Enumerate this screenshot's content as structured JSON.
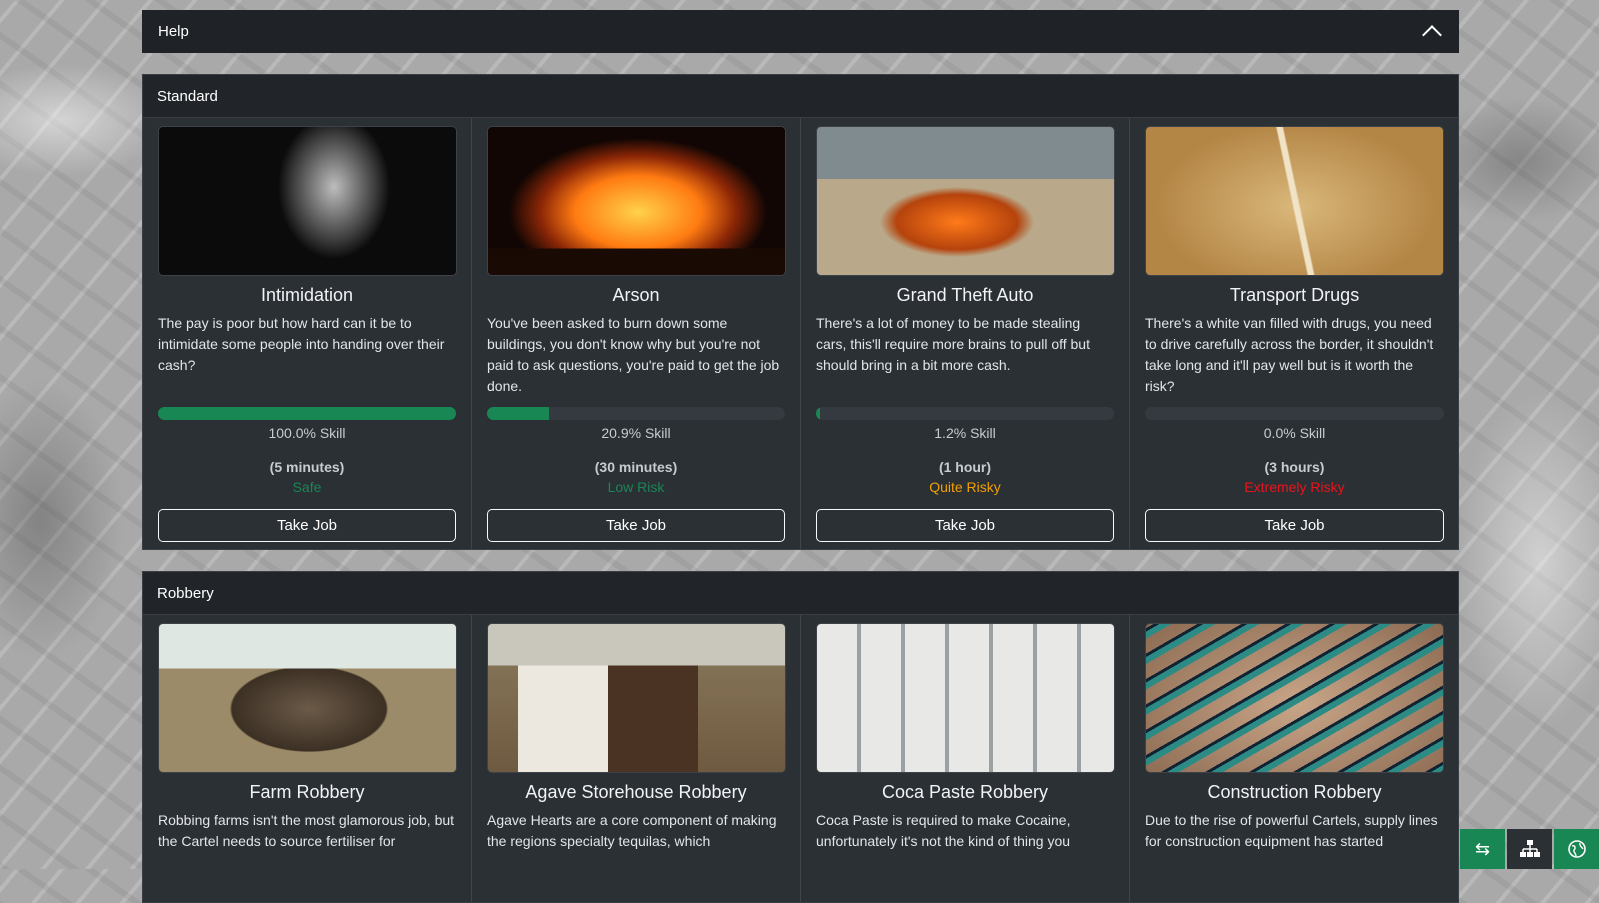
{
  "help": {
    "label": "Help",
    "toggle_icon": "chevron-up-icon"
  },
  "sections": [
    {
      "title": "Standard",
      "jobs": [
        {
          "title": "Intimidation",
          "desc": "The pay is poor but how hard can it be to intimidate some people into handing over their cash?",
          "skill_pct": 100.0,
          "skill": "100.0% Skill",
          "duration": "(5 minutes)",
          "risk": "Safe",
          "risk_color": "#198754",
          "button": "Take Job"
        },
        {
          "title": "Arson",
          "desc": "You've been asked to burn down some buildings, you don't know why but you're not paid to ask questions, you're paid to get the job done.",
          "skill_pct": 20.9,
          "skill": "20.9% Skill",
          "duration": "(30 minutes)",
          "risk": "Low Risk",
          "risk_color": "#198754",
          "button": "Take Job"
        },
        {
          "title": "Grand Theft Auto",
          "desc": "There's a lot of money to be made stealing cars, this'll require more brains to pull off but should bring in a bit more cash.",
          "skill_pct": 1.2,
          "skill": "1.2% Skill",
          "duration": "(1 hour)",
          "risk": "Quite Risky",
          "risk_color": "#f0a000",
          "button": "Take Job"
        },
        {
          "title": "Transport Drugs",
          "desc": "There's a white van filled with drugs, you need to drive carefully across the border, it shouldn't take long and it'll pay well but is it worth the risk?",
          "skill_pct": 0.0,
          "skill": "0.0% Skill",
          "duration": "(3 hours)",
          "risk": "Extremely Risky",
          "risk_color": "#e8141c",
          "button": "Take Job"
        }
      ]
    },
    {
      "title": "Robbery",
      "jobs": [
        {
          "title": "Farm Robbery",
          "desc": "Robbing farms isn't the most glamorous job, but the Cartel needs to source fertiliser for"
        },
        {
          "title": "Agave Storehouse Robbery",
          "desc": "Agave Hearts are a core component of making the regions specialty tequilas, which"
        },
        {
          "title": "Coca Paste Robbery",
          "desc": "Coca Paste is required to make Cocaine, unfortunately it's not the kind of thing you"
        },
        {
          "title": "Construction Robbery",
          "desc": "Due to the rise of powerful Cartels, supply lines for construction equipment has started"
        }
      ]
    }
  ],
  "dock": [
    "swap-icon",
    "sitemap-icon",
    "globe-icon"
  ]
}
